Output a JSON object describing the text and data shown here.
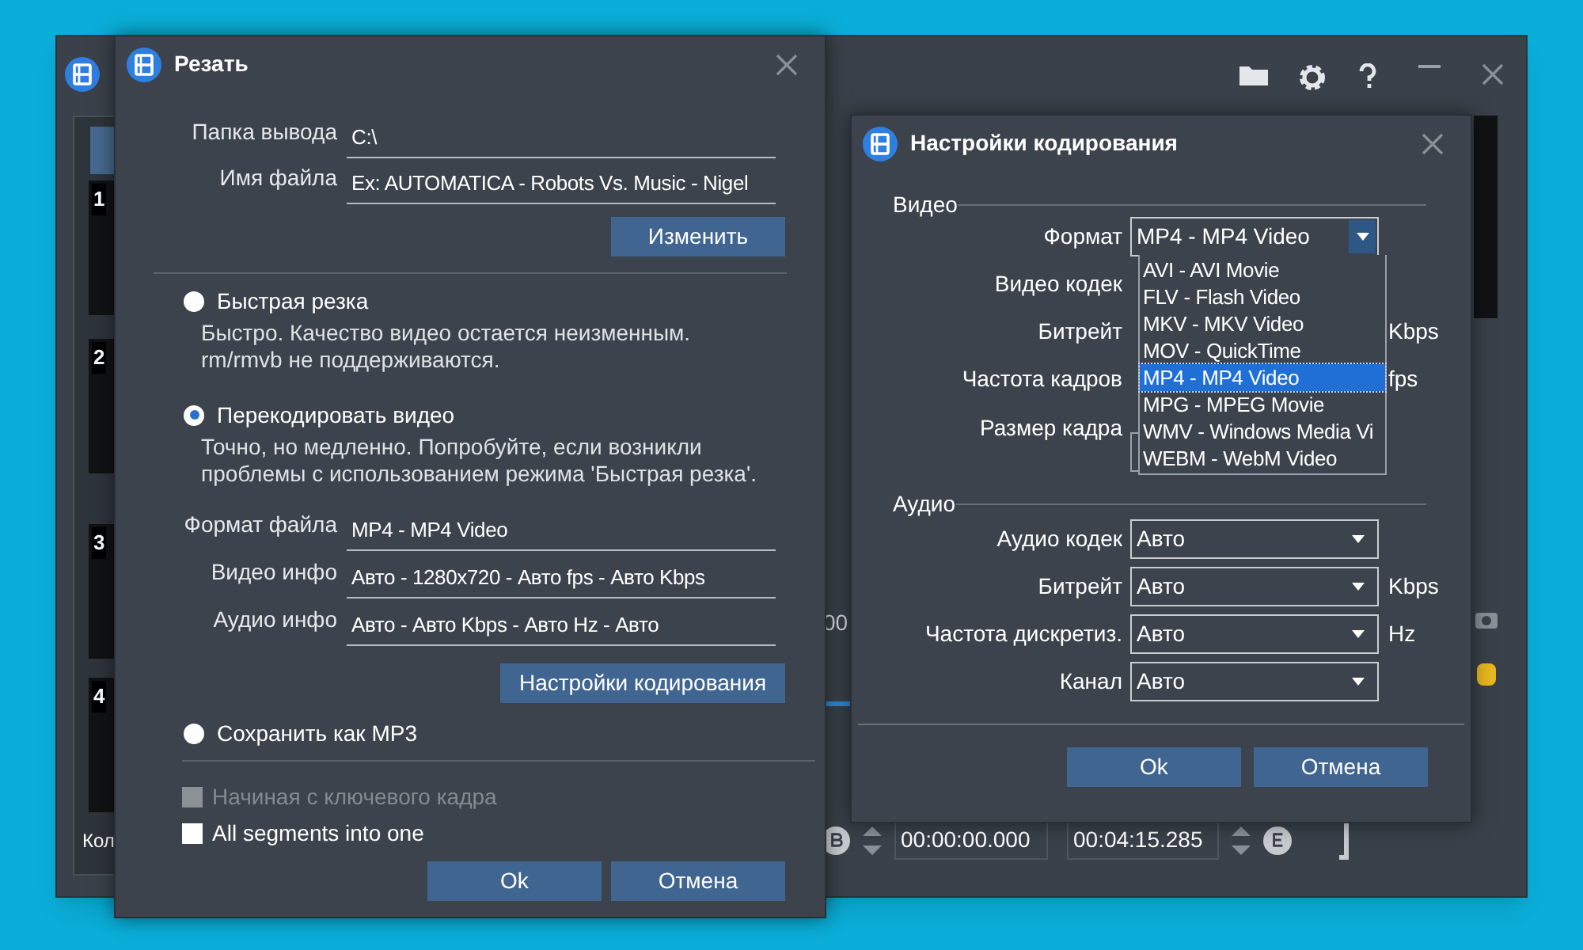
{
  "main_window": {
    "thumbnails": [
      {
        "number": "1"
      },
      {
        "number": "2"
      },
      {
        "number": "3"
      },
      {
        "number": "4"
      }
    ],
    "count_label": "Кол",
    "time_fragment": "00",
    "start_time": "00:00:00.000",
    "end_time": "00:04:15.285"
  },
  "cut_dialog": {
    "title": "Резать",
    "path_fields": [
      {
        "label": "Папка вывода",
        "value": "C:\\"
      },
      {
        "label": "Имя файла",
        "value": "Ex: AUTOMATICA - Robots Vs. Music - Nigel"
      }
    ],
    "change_button": "Изменить",
    "modes": [
      {
        "label": "Быстрая резка",
        "selected": false,
        "description": [
          "Быстро. Качество видео остается неизменным.",
          "rm/rmvb не поддерживаются."
        ]
      },
      {
        "label": "Перекодировать видео",
        "selected": true,
        "description": [
          "Точно, но медленно. Попробуйте, если возникли",
          "проблемы с использованием режима 'Быстрая резка'."
        ]
      }
    ],
    "info_rows": [
      {
        "label": "Формат файла",
        "value": "MP4 - MP4 Video"
      },
      {
        "label": "Видео инфо",
        "value": "Авто - 1280x720 - Авто fps - Авто Kbps"
      },
      {
        "label": "Аудио инфо",
        "value": "Авто - Авто Kbps - Авто Hz - Авто"
      }
    ],
    "encoding_button": "Настройки кодирования",
    "mp3_option": {
      "label": "Сохранить как MP3",
      "selected": false
    },
    "checkboxes": [
      {
        "label": "Начиная с ключевого кадра",
        "checked": false,
        "disabled": true
      },
      {
        "label": "All segments into one",
        "checked": false,
        "disabled": false
      }
    ],
    "buttons": [
      "Ok",
      "Отмена"
    ]
  },
  "encoding_dialog": {
    "title": "Настройки кодирования",
    "video_section": "Видео",
    "video_fields": [
      {
        "kind": "select",
        "label": "Формат",
        "value": "MP4 - MP4 Video",
        "expanded": true
      },
      {
        "kind": "hidden",
        "label": "Видео кодек"
      },
      {
        "kind": "hidden",
        "label": "Битрейт",
        "unit": "Kbps"
      },
      {
        "kind": "hidden",
        "label": "Частота кадров",
        "unit": "fps"
      },
      {
        "kind": "size",
        "label": "Размер кадра"
      }
    ],
    "format_options": [
      {
        "label": "AVI - AVI Movie",
        "selected": false
      },
      {
        "label": "FLV - Flash Video",
        "selected": false
      },
      {
        "label": "MKV - MKV Video",
        "selected": false
      },
      {
        "label": "MOV - QuickTime",
        "selected": false
      },
      {
        "label": "MP4 - MP4 Video",
        "selected": true
      },
      {
        "label": "MPG - MPEG Movie",
        "selected": false
      },
      {
        "label": "WMV - Windows Media Vi",
        "selected": false
      },
      {
        "label": "WEBM - WebM Video",
        "selected": false
      }
    ],
    "audio_section": "Аудио",
    "audio_fields": [
      {
        "label": "Аудио кодек",
        "value": "Авто"
      },
      {
        "label": "Битрейт",
        "value": "Авто",
        "unit": "Kbps"
      },
      {
        "label": "Частота дискретиз.",
        "value": "Авто",
        "unit": "Hz"
      },
      {
        "label": "Канал",
        "value": "Авто"
      }
    ],
    "buttons": [
      "Ok",
      "Отмена"
    ]
  }
}
